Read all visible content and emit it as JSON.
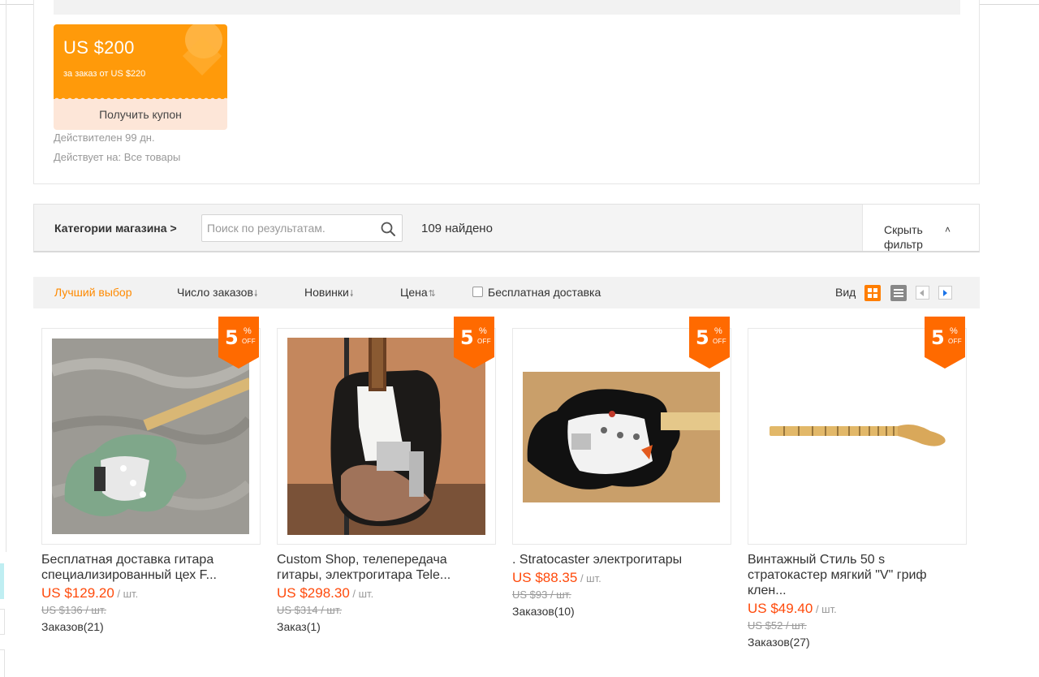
{
  "coupon": {
    "amount": "US $200",
    "condition": "за заказ от US $220",
    "button": "Получить купон",
    "valid": "Действителен 99 дн.",
    "applies": "Действует на: Все товары"
  },
  "search_bar": {
    "store_categories": "Категории магазина >",
    "placeholder": "Поиск по результатам.",
    "found": "109 найдено",
    "hide_filter": "Скрыть фильтр",
    "hide_filter_chevron": "˄"
  },
  "sort_bar": {
    "best_match": "Лучший выбор",
    "orders": "Число заказов",
    "newest": "Новинки",
    "price": "Цена",
    "down_arrow": "🠗",
    "updown_arrow": "⇅",
    "free_shipping": "Бесплатная доставка",
    "view": "Вид"
  },
  "discount_badge": {
    "number": "5",
    "percent": "%",
    "off": "OFF",
    "color": "#ff6a00"
  },
  "colors": {
    "accent": "#ff8a00",
    "price": "#ff4a0b",
    "coupon": "#ff9a0a"
  },
  "products": [
    {
      "title": "Бесплатная доставка гитара специализированный цех F...",
      "price": "US $129.20",
      "unit": " / шт.",
      "old_price": "US $136 / шт.",
      "orders": "Заказов(21)",
      "image": "seafoam-green-stratocaster-guitar"
    },
    {
      "title": "Custom Shop, телепередача гитары, электрогитара Tele...",
      "price": "US $298.30",
      "unit": " / шт.",
      "old_price": "US $314 / шт.",
      "orders": "Заказ(1)",
      "image": "relic-black-telecaster-guitar"
    },
    {
      "title": ". Stratocaster электрогитары",
      "price": "US $88.35",
      "unit": " / шт.",
      "old_price": "US $93 / шт.",
      "orders": "Заказов(10)",
      "image": "black-stratocaster-guitar"
    },
    {
      "title": "Винтажный Стиль 50 s стратокастер мягкий \"V\" гриф клен...",
      "price": "US $49.40",
      "unit": " / шт.",
      "old_price": "US $52 / шт.",
      "orders": "Заказов(27)",
      "image": "maple-guitar-neck"
    }
  ]
}
